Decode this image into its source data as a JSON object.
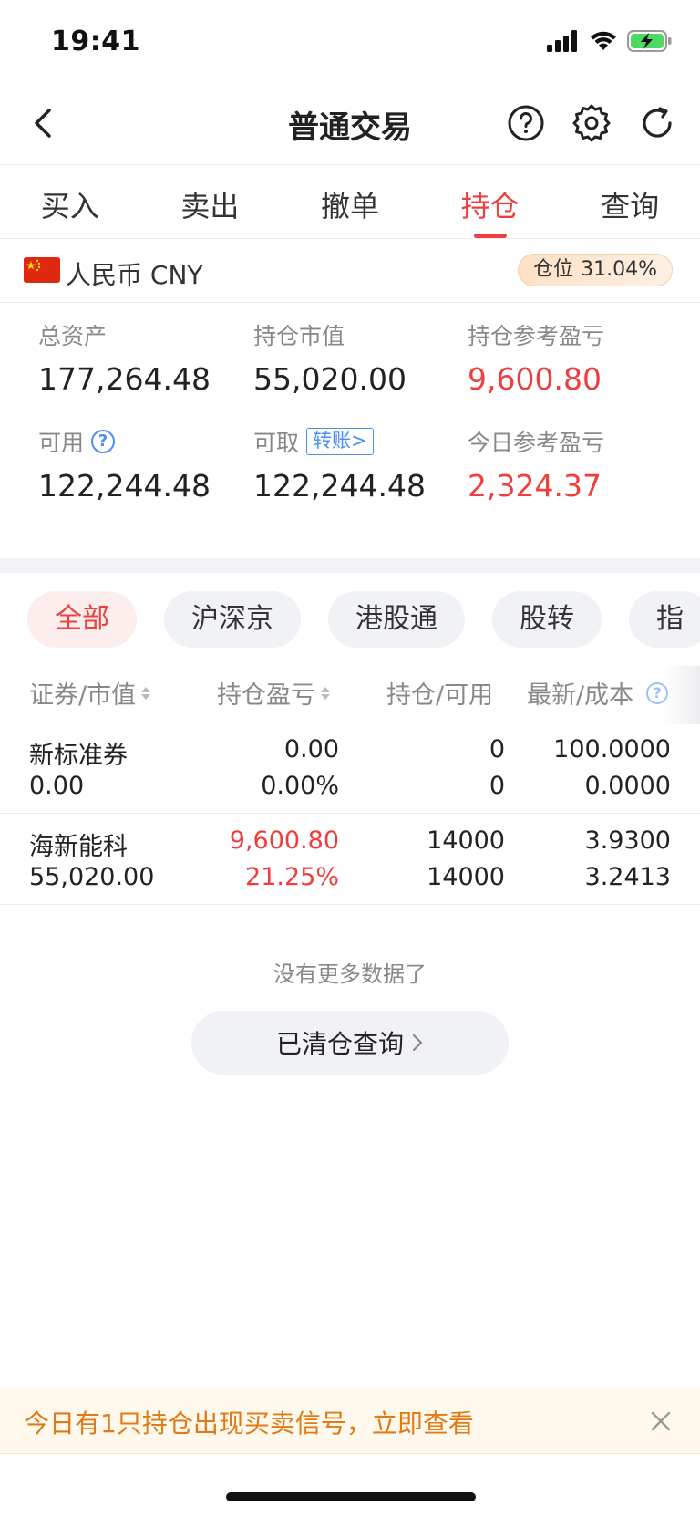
{
  "status_bar": {
    "time": "19:41"
  },
  "nav": {
    "title": "普通交易"
  },
  "main_tabs": [
    {
      "label": "买入",
      "active": false
    },
    {
      "label": "卖出",
      "active": false
    },
    {
      "label": "撤单",
      "active": false
    },
    {
      "label": "持仓",
      "active": true
    },
    {
      "label": "查询",
      "active": false
    }
  ],
  "currency": {
    "label": "人民币 CNY",
    "position_label": "仓位",
    "position_value": "31.04%"
  },
  "assets": {
    "total_assets": {
      "label": "总资产",
      "value": "177,264.48"
    },
    "holding_value": {
      "label": "持仓市值",
      "value": "55,020.00"
    },
    "holding_pnl": {
      "label": "持仓参考盈亏",
      "value": "9,600.80"
    },
    "available": {
      "label": "可用",
      "value": "122,244.48"
    },
    "withdrawable": {
      "label": "可取",
      "transfer_label": "转账>",
      "value": "122,244.48"
    },
    "today_pnl": {
      "label": "今日参考盈亏",
      "value": "2,324.37"
    }
  },
  "filters": [
    {
      "label": "全部",
      "active": true
    },
    {
      "label": "沪深京",
      "active": false
    },
    {
      "label": "港股通",
      "active": false
    },
    {
      "label": "股转",
      "active": false
    },
    {
      "label": "指",
      "active": false
    }
  ],
  "table": {
    "headers": [
      "证券/市值",
      "持仓盈亏",
      "持仓/可用",
      "最新/成本"
    ],
    "rows": [
      {
        "name": "新标准券",
        "market_value": "0.00",
        "pnl": "0.00",
        "pnl_pct": "0.00%",
        "holding": "0",
        "available": "0",
        "latest": "100.0000",
        "cost": "0.0000",
        "red": false
      },
      {
        "name": "海新能科",
        "market_value": "55,020.00",
        "pnl": "9,600.80",
        "pnl_pct": "21.25%",
        "holding": "14000",
        "available": "14000",
        "latest": "3.9300",
        "cost": "3.2413",
        "red": true
      }
    ]
  },
  "no_more_text": "没有更多数据了",
  "cleared_button": "已清仓查询",
  "notice": {
    "text": "今日有1只持仓出现买卖信号，立即查看"
  },
  "colors": {
    "accent_red": "#f03e3e",
    "link_blue": "#4d8ef7",
    "notice_orange": "#e07a16"
  }
}
